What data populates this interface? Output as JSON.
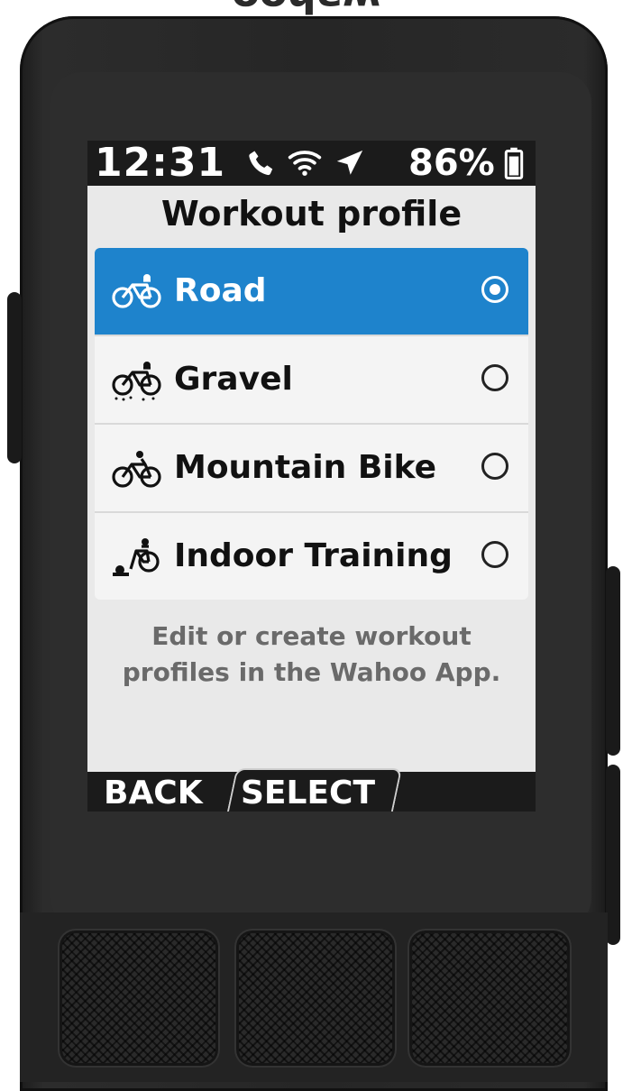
{
  "brand": {
    "logo_text": "wahoo"
  },
  "status_bar": {
    "time": "12:31",
    "battery_percent": "86%",
    "icons": [
      "phone-icon",
      "wifi-icon",
      "navigation-arrow-icon",
      "battery-icon"
    ]
  },
  "screen": {
    "title": "Workout profile",
    "profiles": [
      {
        "label": "Road",
        "icon": "road-bike-icon",
        "selected": true
      },
      {
        "label": "Gravel",
        "icon": "gravel-bike-icon",
        "selected": false
      },
      {
        "label": "Mountain Bike",
        "icon": "mountain-bike-icon",
        "selected": false
      },
      {
        "label": "Indoor Training",
        "icon": "indoor-trainer-icon",
        "selected": false
      }
    ],
    "hint_line1": "Edit or create workout",
    "hint_line2": "profiles in the Wahoo App."
  },
  "softkeys": {
    "back": "BACK",
    "select": "SELECT"
  },
  "colors": {
    "accent": "#1e83cc",
    "screen_bg": "#e9e9e9",
    "bar_bg": "#1b1b1b",
    "device": "#262626"
  }
}
